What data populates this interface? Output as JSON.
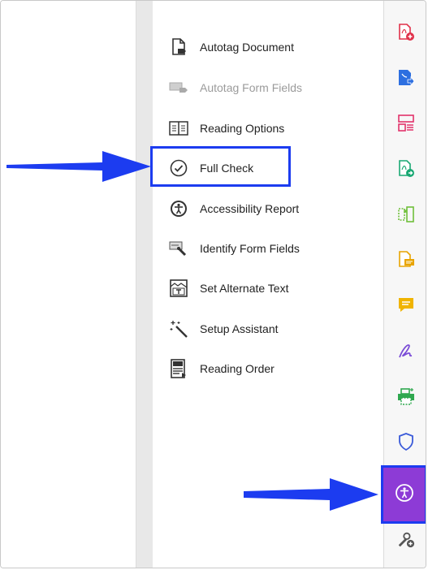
{
  "tools_panel": {
    "items": [
      {
        "label": "Autotag Document",
        "icon": "autotag-document-icon",
        "enabled": true
      },
      {
        "label": "Autotag Form Fields",
        "icon": "autotag-form-fields-icon",
        "enabled": false
      },
      {
        "label": "Reading Options",
        "icon": "reading-options-icon",
        "enabled": true
      },
      {
        "label": "Full Check",
        "icon": "full-check-icon",
        "enabled": true,
        "highlighted": true
      },
      {
        "label": "Accessibility Report",
        "icon": "accessibility-report-icon",
        "enabled": true
      },
      {
        "label": "Identify Form Fields",
        "icon": "identify-form-fields-icon",
        "enabled": true
      },
      {
        "label": "Set Alternate Text",
        "icon": "set-alternate-text-icon",
        "enabled": true
      },
      {
        "label": "Setup Assistant",
        "icon": "setup-assistant-icon",
        "enabled": true
      },
      {
        "label": "Reading Order",
        "icon": "reading-order-icon",
        "enabled": true
      }
    ]
  },
  "right_rail": {
    "icons": [
      {
        "name": "create-pdf-icon",
        "color": "#e0314a"
      },
      {
        "name": "export-pdf-icon",
        "color": "#2d6fe0"
      },
      {
        "name": "organize-pages-icon",
        "color": "#e2326b"
      },
      {
        "name": "send-for-review-icon",
        "color": "#19a873"
      },
      {
        "name": "compress-icon",
        "color": "#6fbf3a"
      },
      {
        "name": "comment-file-icon",
        "color": "#e8a400"
      },
      {
        "name": "comment-icon",
        "color": "#f0b400"
      },
      {
        "name": "fill-sign-icon",
        "color": "#7a4bd6"
      },
      {
        "name": "print-production-icon",
        "color": "#2fa84f"
      },
      {
        "name": "protect-icon",
        "color": "#3a5ad9"
      },
      {
        "name": "accessibility-icon",
        "color": "#ffffff",
        "active": true,
        "background": "#8d3bd6"
      },
      {
        "name": "more-tools-icon",
        "color": "#555555"
      }
    ]
  },
  "annotations": {
    "highlight_color": "#1c3cf0",
    "arrow_color": "#1c3cf0"
  }
}
